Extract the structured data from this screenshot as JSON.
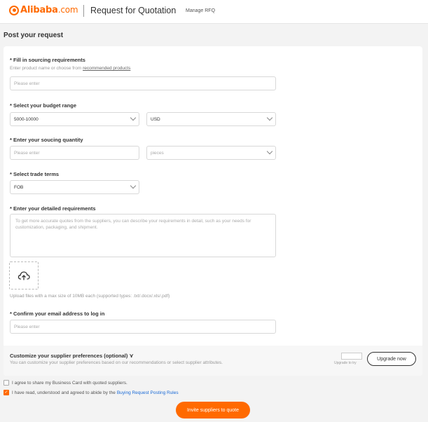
{
  "header": {
    "brand_name": "Alibaba",
    "brand_suffix": ".com",
    "title": "Request for Quotation",
    "manage_link": "Manage RFQ"
  },
  "page": {
    "section_title": "Post your request"
  },
  "form": {
    "sourcing": {
      "label": "* Fill in sourcing requirements",
      "hint_prefix": "Enter product name or choose from ",
      "hint_link": "recommended products",
      "placeholder": "Please enter"
    },
    "budget": {
      "label": "* Select your budget range",
      "range_value": "5000-10000",
      "currency_value": "USD"
    },
    "quantity": {
      "label": "* Enter your soucing quantity",
      "placeholder": "Please enter",
      "unit_value": "pieces"
    },
    "trade_terms": {
      "label": "* Select trade terms",
      "value": "FOB"
    },
    "details": {
      "label": "* Enter your detailed requirements",
      "placeholder": "To get more accurate quotes from the suppliers, you can describe your requirements in detail, such as your needs for customization, packaging, and shipment.",
      "upload_hint": "Upload files with a max size of 10MB each (supported types: .txt/.docx/.xls/.pdf)"
    },
    "email": {
      "label": "* Confirm your email address to log in",
      "placeholder": "Please enter"
    }
  },
  "preferences": {
    "title": "Customize your supplier preferences (optional)",
    "subtitle": "You can customize your supplier preferences based on our recommendations or select supplier attributes.",
    "try_label": "Upgrade to try",
    "upgrade_button": "Upgrade now"
  },
  "agreements": {
    "share_card": "I agree to share my Business Card with quoted suppliers.",
    "share_card_checked": false,
    "rules_prefix": "I have read, understood and agreed to abide by the ",
    "rules_link": "Buying Request Posting Rules",
    "rules_checked": true
  },
  "submit_button": "Invite suppliers to quote",
  "colors": {
    "brand": "#ff6a00",
    "link": "#1a6ad6"
  },
  "icons": {
    "upload": "cloud-upload-icon",
    "expand": "double-chevron-down-icon",
    "dropdown": "chevron-down-icon"
  }
}
